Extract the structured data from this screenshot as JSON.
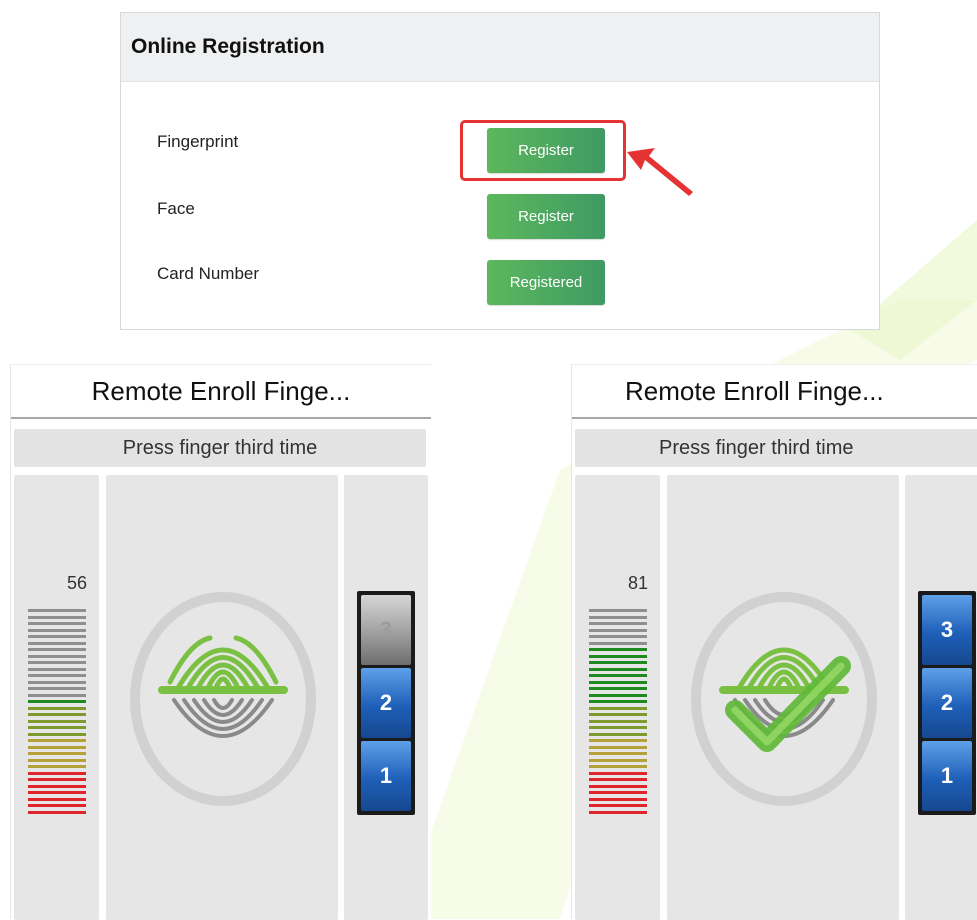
{
  "registration": {
    "title": "Online Registration",
    "rows": [
      {
        "label": "Fingerprint",
        "button": "Register"
      },
      {
        "label": "Face",
        "button": "Register"
      },
      {
        "label": "Card Number",
        "button": "Registered"
      }
    ],
    "button_color": "#4caf5a",
    "highlight_color": "#e53232"
  },
  "devices": [
    {
      "title": "Remote Enroll Finge...",
      "status": "Press finger third time",
      "quality": "56",
      "steps": [
        "3",
        "2",
        "1"
      ],
      "steps_completed": 2,
      "captured": false
    },
    {
      "title": "Remote Enroll Finge...",
      "status": "Press finger third time",
      "quality": "81",
      "steps": [
        "3",
        "2",
        "1"
      ],
      "steps_completed": 3,
      "captured": true
    }
  ]
}
